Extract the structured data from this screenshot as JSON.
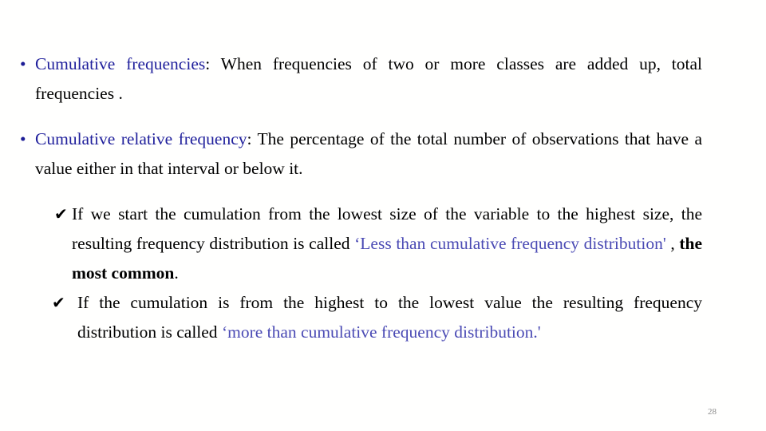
{
  "slide": {
    "page_number": "28",
    "colors": {
      "heading_blue": "#20209c",
      "quoted_purple": "#4a4ab4",
      "bullet_dot": "#1d1d96",
      "body_black": "#000000",
      "page_number_gray": "#8a8a8a",
      "background": "#fffffe"
    },
    "bullets": [
      {
        "marker": "•",
        "lead": "Cumulative frequencies",
        "colon": ":",
        "body": " When frequencies of two or more classes are added up, total frequencies ."
      },
      {
        "marker": "•",
        "lead": "Cumulative relative frequency",
        "colon": ":",
        "body": " The percentage of the total number of observations that have a value either in that interval or below it."
      }
    ],
    "sub_bullets": [
      {
        "marker": "✔",
        "text_before": "If we start the cumulation from the lowest size of the variable to the highest size, the resulting frequency distribution is called ",
        "quoted": "‘Less than cumulative frequency distribution'",
        "text_middle": " , ",
        "emphasis": "the most common",
        "text_after": "."
      },
      {
        "marker": "✔",
        "text_before": " If the cumulation is from the highest to the lowest value the resulting frequency distribution is called ",
        "quoted": "‘more than cumulative frequency distribution.'",
        "text_middle": "",
        "emphasis": "",
        "text_after": ""
      }
    ]
  }
}
